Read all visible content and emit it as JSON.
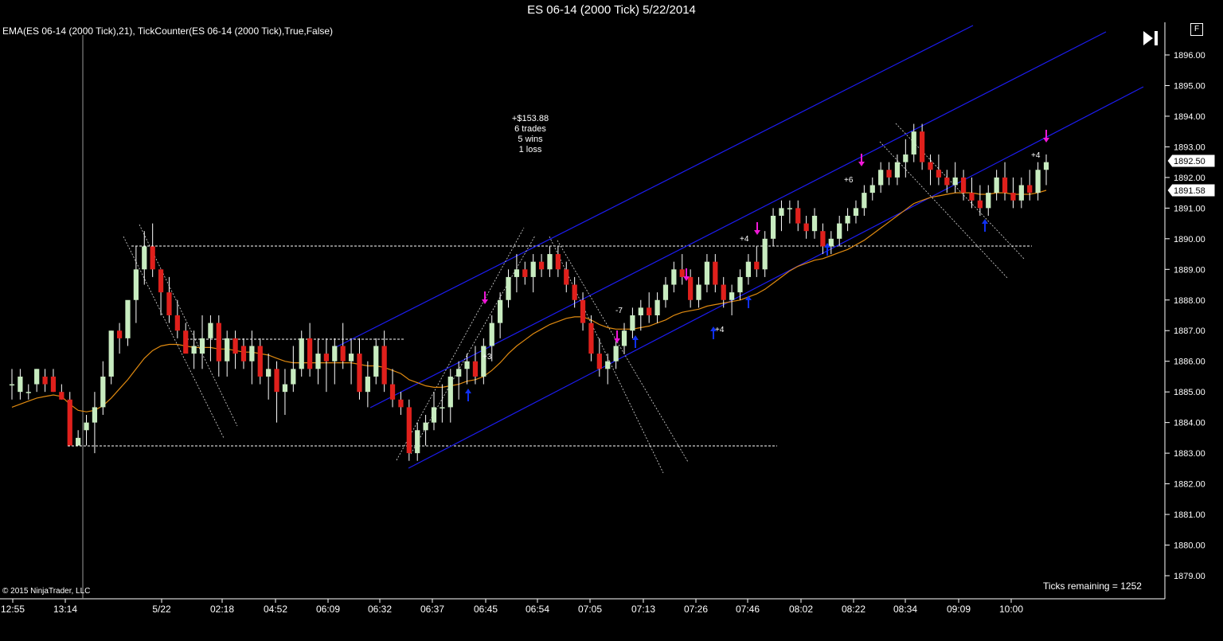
{
  "window": {
    "title": "ES 06-14 (2000 Tick)  5/22/2014"
  },
  "indicator_label": "EMA(ES 06-14 (2000 Tick),21),  TickCounter(ES 06-14 (2000 Tick),True,False)",
  "copyright": "© 2015 NinjaTrader, LLC",
  "ticks_remaining": "Ticks remaining = 1252",
  "buttons": {
    "play": "skip-to-end-icon",
    "f_label": "F"
  },
  "stats": {
    "pnl": "+$153.88",
    "trades": "6 trades",
    "wins": "5 wins",
    "loss": "1 loss"
  },
  "trade_labels": [
    "+3",
    "-7",
    "+4",
    "+4",
    "+6",
    "+4"
  ],
  "price_boxes": {
    "last": "1892.50",
    "ema": "1891.58"
  },
  "colors": {
    "up_candle": "#c8ecc0",
    "down_candle": "#e0201c",
    "ema": "#e08a10",
    "channel": "#1c1cf0",
    "buy_arrow": "#1030f0",
    "sell_arrow": "#f018d8",
    "background": "#000000"
  },
  "chart_data": {
    "type": "candlestick",
    "title": "ES 06-14 (2000 Tick)  5/22/2014",
    "y_axis_ticks": [
      "1896.00",
      "1895.00",
      "1894.00",
      "1893.00",
      "1892.00",
      "1891.00",
      "1890.00",
      "1889.00",
      "1888.00",
      "1887.00",
      "1886.00",
      "1885.00",
      "1884.00",
      "1883.00",
      "1882.00",
      "1881.00",
      "1880.00",
      "1879.00"
    ],
    "x_axis_ticks": [
      "12:55",
      "13:14",
      "5/22",
      "02:18",
      "04:52",
      "06:09",
      "06:32",
      "06:37",
      "06:45",
      "06:54",
      "07:05",
      "07:13",
      "07:26",
      "07:46",
      "08:02",
      "08:22",
      "08:34",
      "09:09",
      "10:00"
    ],
    "ylim": [
      1878.6,
      1896.6
    ],
    "last_price": 1892.5,
    "ema_value": 1891.58,
    "ohlc": [
      [
        1885.25,
        1885.75,
        1884.75,
        1885.25
      ],
      [
        1885.0,
        1885.75,
        1884.75,
        1885.5
      ],
      [
        1885.0,
        1885.25,
        1884.75,
        1885.0
      ],
      [
        1885.25,
        1885.75,
        1885.0,
        1885.75
      ],
      [
        1885.5,
        1885.75,
        1885.0,
        1885.25
      ],
      [
        1885.5,
        1885.75,
        1885.0,
        1885.0
      ],
      [
        1885.0,
        1885.25,
        1884.75,
        1884.75
      ],
      [
        1884.75,
        1885.0,
        1883.25,
        1883.25
      ],
      [
        1883.25,
        1883.75,
        1883.25,
        1883.5
      ],
      [
        1883.75,
        1884.25,
        1883.25,
        1884.0
      ],
      [
        1884.0,
        1885.0,
        1883.0,
        1884.5
      ],
      [
        1884.5,
        1886.0,
        1884.25,
        1885.5
      ],
      [
        1885.5,
        1887.0,
        1885.25,
        1887.0
      ],
      [
        1887.0,
        1887.25,
        1886.25,
        1886.75
      ],
      [
        1886.75,
        1887.75,
        1886.5,
        1888.0
      ],
      [
        1888.0,
        1889.75,
        1887.25,
        1889.0
      ],
      [
        1889.0,
        1890.25,
        1888.5,
        1889.75
      ],
      [
        1889.75,
        1890.5,
        1888.75,
        1889.0
      ],
      [
        1889.0,
        1889.0,
        1887.5,
        1888.25
      ],
      [
        1888.25,
        1888.75,
        1887.25,
        1887.5
      ],
      [
        1887.5,
        1888.0,
        1886.75,
        1887.0
      ],
      [
        1887.0,
        1887.25,
        1886.5,
        1886.25
      ],
      [
        1886.25,
        1887.0,
        1885.75,
        1886.5
      ],
      [
        1886.25,
        1887.5,
        1885.75,
        1886.75
      ],
      [
        1886.75,
        1887.5,
        1886.0,
        1887.25
      ],
      [
        1887.25,
        1887.5,
        1885.5,
        1886.0
      ],
      [
        1886.0,
        1887.0,
        1885.5,
        1886.75
      ],
      [
        1886.75,
        1887.0,
        1885.75,
        1886.25
      ],
      [
        1886.5,
        1886.75,
        1885.75,
        1886.0
      ],
      [
        1886.0,
        1887.0,
        1885.25,
        1886.5
      ],
      [
        1886.5,
        1886.75,
        1885.25,
        1885.5
      ],
      [
        1885.5,
        1886.25,
        1884.75,
        1885.75
      ],
      [
        1885.75,
        1886.0,
        1884.0,
        1885.0
      ],
      [
        1885.0,
        1885.75,
        1884.25,
        1885.25
      ],
      [
        1885.25,
        1886.5,
        1885.0,
        1885.75
      ],
      [
        1885.75,
        1887.0,
        1885.5,
        1886.75
      ],
      [
        1886.75,
        1887.25,
        1885.5,
        1885.75
      ],
      [
        1885.75,
        1886.75,
        1885.25,
        1886.25
      ],
      [
        1886.25,
        1886.75,
        1885.0,
        1886.0
      ],
      [
        1886.0,
        1886.75,
        1885.25,
        1886.5
      ],
      [
        1886.5,
        1887.25,
        1885.75,
        1886.0
      ],
      [
        1886.0,
        1886.75,
        1885.25,
        1886.25
      ],
      [
        1886.25,
        1886.75,
        1884.75,
        1885.0
      ],
      [
        1885.0,
        1886.0,
        1884.5,
        1885.5
      ],
      [
        1885.5,
        1886.75,
        1885.25,
        1886.5
      ],
      [
        1886.5,
        1887.0,
        1885.0,
        1885.25
      ],
      [
        1885.25,
        1885.75,
        1884.5,
        1884.75
      ],
      [
        1884.75,
        1885.0,
        1884.25,
        1884.5
      ],
      [
        1884.5,
        1884.75,
        1882.75,
        1883.0
      ],
      [
        1883.0,
        1884.0,
        1882.75,
        1883.75
      ],
      [
        1883.75,
        1884.25,
        1883.25,
        1884.0
      ],
      [
        1884.0,
        1885.0,
        1883.75,
        1884.5
      ],
      [
        1884.5,
        1885.25,
        1884.0,
        1884.5
      ],
      [
        1884.5,
        1885.75,
        1884.0,
        1885.5
      ],
      [
        1885.5,
        1886.0,
        1884.75,
        1885.75
      ],
      [
        1885.75,
        1886.25,
        1885.25,
        1886.0
      ],
      [
        1886.0,
        1886.5,
        1885.25,
        1885.5
      ],
      [
        1885.5,
        1886.75,
        1885.25,
        1886.5
      ],
      [
        1886.5,
        1887.5,
        1886.0,
        1887.25
      ],
      [
        1887.25,
        1888.25,
        1886.75,
        1888.0
      ],
      [
        1888.0,
        1889.0,
        1887.75,
        1888.75
      ],
      [
        1888.75,
        1889.5,
        1888.25,
        1889.0
      ],
      [
        1889.0,
        1889.25,
        1888.5,
        1888.75
      ],
      [
        1888.75,
        1889.5,
        1888.25,
        1889.25
      ],
      [
        1889.25,
        1889.5,
        1888.75,
        1889.0
      ],
      [
        1889.0,
        1889.75,
        1888.75,
        1889.5
      ],
      [
        1889.5,
        1889.75,
        1888.75,
        1889.0
      ],
      [
        1889.0,
        1889.25,
        1888.25,
        1888.5
      ],
      [
        1888.5,
        1888.75,
        1887.75,
        1888.0
      ],
      [
        1888.0,
        1888.25,
        1887.0,
        1887.25
      ],
      [
        1887.25,
        1887.5,
        1886.0,
        1886.25
      ],
      [
        1886.25,
        1886.75,
        1885.5,
        1885.75
      ],
      [
        1885.75,
        1886.25,
        1885.25,
        1886.0
      ],
      [
        1886.0,
        1886.75,
        1885.75,
        1886.5
      ],
      [
        1886.5,
        1887.25,
        1886.25,
        1887.0
      ],
      [
        1887.0,
        1887.75,
        1886.75,
        1887.5
      ],
      [
        1887.5,
        1888.0,
        1887.0,
        1887.75
      ],
      [
        1887.75,
        1888.25,
        1887.25,
        1887.5
      ],
      [
        1887.5,
        1888.25,
        1887.25,
        1888.0
      ],
      [
        1888.0,
        1888.75,
        1887.75,
        1888.5
      ],
      [
        1888.5,
        1889.25,
        1888.25,
        1889.0
      ],
      [
        1889.0,
        1889.5,
        1888.5,
        1888.75
      ],
      [
        1888.75,
        1889.0,
        1887.75,
        1888.0
      ],
      [
        1888.0,
        1888.75,
        1887.75,
        1888.5
      ],
      [
        1888.5,
        1889.5,
        1888.25,
        1889.25
      ],
      [
        1889.25,
        1889.5,
        1888.25,
        1888.5
      ],
      [
        1888.5,
        1888.75,
        1887.75,
        1888.0
      ],
      [
        1888.0,
        1888.5,
        1887.5,
        1888.25
      ],
      [
        1888.25,
        1889.0,
        1888.0,
        1888.75
      ],
      [
        1888.75,
        1889.5,
        1888.5,
        1889.25
      ],
      [
        1889.25,
        1889.75,
        1888.75,
        1889.0
      ],
      [
        1889.0,
        1890.25,
        1888.75,
        1890.0
      ],
      [
        1890.0,
        1891.0,
        1889.75,
        1890.75
      ],
      [
        1890.75,
        1891.25,
        1890.25,
        1891.0
      ],
      [
        1891.0,
        1891.25,
        1890.5,
        1891.0
      ],
      [
        1891.0,
        1891.25,
        1890.25,
        1890.5
      ],
      [
        1890.5,
        1890.75,
        1890.0,
        1890.25
      ],
      [
        1890.25,
        1891.0,
        1890.0,
        1890.75
      ],
      [
        1890.25,
        1890.5,
        1889.5,
        1889.75
      ],
      [
        1889.75,
        1890.25,
        1889.5,
        1890.0
      ],
      [
        1890.0,
        1890.75,
        1889.75,
        1890.5
      ],
      [
        1890.5,
        1891.0,
        1890.25,
        1890.75
      ],
      [
        1890.75,
        1891.25,
        1890.5,
        1891.0
      ],
      [
        1891.0,
        1891.75,
        1890.75,
        1891.5
      ],
      [
        1891.5,
        1892.0,
        1891.25,
        1891.75
      ],
      [
        1891.75,
        1892.5,
        1891.5,
        1892.25
      ],
      [
        1892.25,
        1892.5,
        1891.75,
        1892.0
      ],
      [
        1892.0,
        1892.75,
        1891.75,
        1892.5
      ],
      [
        1892.5,
        1893.25,
        1892.0,
        1892.75
      ],
      [
        1892.75,
        1893.75,
        1892.5,
        1893.5
      ],
      [
        1893.5,
        1893.75,
        1892.25,
        1892.5
      ],
      [
        1892.5,
        1892.75,
        1891.75,
        1892.25
      ],
      [
        1892.25,
        1892.75,
        1891.75,
        1892.0
      ],
      [
        1892.0,
        1892.25,
        1891.5,
        1891.75
      ],
      [
        1891.75,
        1892.5,
        1891.5,
        1892.0
      ],
      [
        1892.0,
        1892.25,
        1891.25,
        1891.5
      ],
      [
        1891.5,
        1892.0,
        1891.0,
        1891.25
      ],
      [
        1891.25,
        1891.75,
        1890.75,
        1891.0
      ],
      [
        1891.0,
        1891.75,
        1890.75,
        1891.5
      ],
      [
        1891.5,
        1892.25,
        1891.25,
        1892.0
      ],
      [
        1892.0,
        1892.5,
        1891.25,
        1891.5
      ],
      [
        1891.5,
        1892.0,
        1891.0,
        1891.25
      ],
      [
        1891.25,
        1892.0,
        1891.0,
        1891.75
      ],
      [
        1891.75,
        1892.25,
        1891.25,
        1891.5
      ],
      [
        1891.5,
        1892.5,
        1891.25,
        1892.25
      ],
      [
        1892.25,
        1892.75,
        1891.75,
        1892.5
      ]
    ],
    "ema_series": [
      1884.5,
      1884.6,
      1884.7,
      1884.8,
      1884.85,
      1884.9,
      1884.85,
      1884.6,
      1884.4,
      1884.35,
      1884.4,
      1884.55,
      1884.8,
      1885.1,
      1885.4,
      1885.75,
      1886.1,
      1886.35,
      1886.5,
      1886.55,
      1886.55,
      1886.5,
      1886.45,
      1886.45,
      1886.45,
      1886.4,
      1886.4,
      1886.35,
      1886.3,
      1886.3,
      1886.25,
      1886.2,
      1886.1,
      1886.0,
      1885.95,
      1885.95,
      1885.95,
      1885.95,
      1885.95,
      1885.95,
      1885.95,
      1885.95,
      1885.9,
      1885.85,
      1885.85,
      1885.8,
      1885.7,
      1885.6,
      1885.4,
      1885.3,
      1885.2,
      1885.15,
      1885.15,
      1885.2,
      1885.25,
      1885.35,
      1885.4,
      1885.5,
      1885.7,
      1885.95,
      1886.25,
      1886.5,
      1886.7,
      1886.9,
      1887.05,
      1887.2,
      1887.3,
      1887.4,
      1887.45,
      1887.45,
      1887.35,
      1887.2,
      1887.1,
      1887.05,
      1887.05,
      1887.05,
      1887.1,
      1887.15,
      1887.25,
      1887.35,
      1887.5,
      1887.6,
      1887.65,
      1887.7,
      1887.8,
      1887.85,
      1887.9,
      1887.95,
      1888.0,
      1888.1,
      1888.2,
      1888.35,
      1888.55,
      1888.75,
      1888.95,
      1889.1,
      1889.2,
      1889.3,
      1889.35,
      1889.45,
      1889.55,
      1889.65,
      1889.8,
      1889.95,
      1890.15,
      1890.35,
      1890.55,
      1890.75,
      1890.95,
      1891.15,
      1891.25,
      1891.35,
      1891.4,
      1891.45,
      1891.5,
      1891.5,
      1891.5,
      1891.45,
      1891.45,
      1891.5,
      1891.5,
      1891.45,
      1891.45,
      1891.45,
      1891.5,
      1891.58
    ]
  }
}
